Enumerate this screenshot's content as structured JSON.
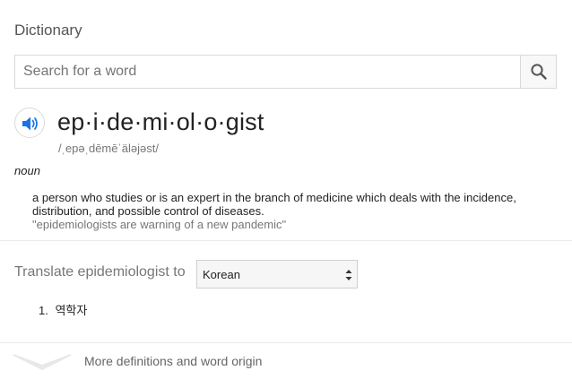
{
  "header": {
    "title": "Dictionary"
  },
  "search": {
    "placeholder": "Search for a word",
    "value": "",
    "button_icon": "search-icon"
  },
  "entry": {
    "audio_icon": "speaker-icon",
    "headword": "ep·i·de·mi·ol·o·gist",
    "phonetic": "/ˌepəˌdēmēˈäləjəst/",
    "part_of_speech": "noun",
    "definition": "a person who studies or is an expert in the branch of medicine which deals with the incidence, distribution, and possible control of diseases.",
    "example": "\"epidemiologists are warning of a new pandemic\""
  },
  "translate": {
    "label": "Translate epidemiologist to",
    "language": "Korean",
    "results": [
      {
        "number": "1.",
        "text": "역학자"
      }
    ]
  },
  "footer": {
    "expand_icon": "chevron-down-icon",
    "more_label": "More definitions and word origin"
  },
  "colors": {
    "accent": "#1a73e8",
    "text_primary": "#222222",
    "text_muted": "#777777",
    "border": "#d9d9d9"
  }
}
